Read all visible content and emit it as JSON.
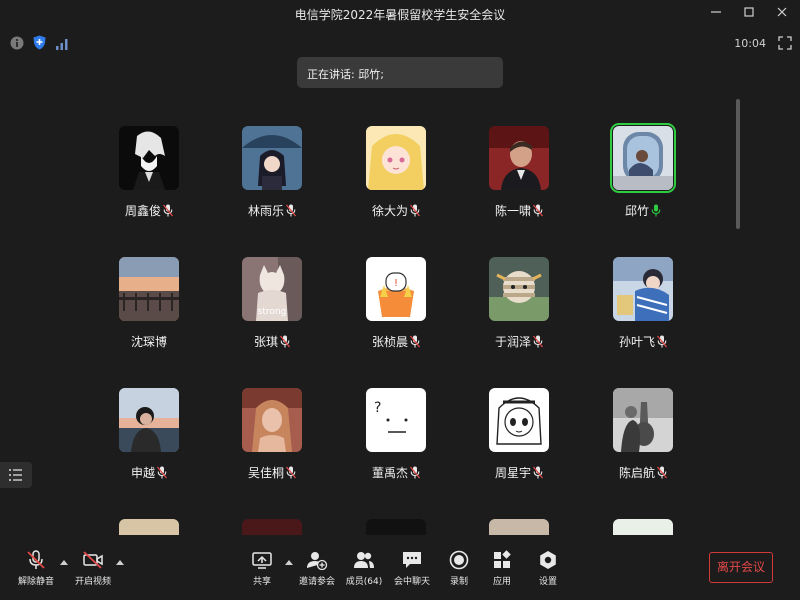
{
  "window": {
    "title": "电信学院2022年暑假留校学生安全会议",
    "min_icon": "minimize-icon",
    "max_icon": "maximize-icon",
    "close_icon": "close-icon"
  },
  "status": {
    "time": "10:04",
    "icons": [
      "info-icon",
      "shield-icon",
      "signal-icon",
      "fullscreen-icon"
    ]
  },
  "speaking": {
    "text": "正在讲话: 邱竹;"
  },
  "participants": [
    {
      "name": "周鑫俊",
      "mic": "muted",
      "avatar_color": "#0b0b0b",
      "avatar_desc": "anime-white-hair"
    },
    {
      "name": "林雨乐",
      "mic": "muted",
      "avatar_color": "#3b5b7a",
      "avatar_desc": "anime-umbrella"
    },
    {
      "name": "徐大为",
      "mic": "muted",
      "avatar_color": "#f0d27a",
      "avatar_desc": "anime-blonde"
    },
    {
      "name": "陈一啸",
      "mic": "muted",
      "avatar_color": "#7a1f1f",
      "avatar_desc": "man-portrait"
    },
    {
      "name": "邱竹",
      "mic": "speaking",
      "avatar_color": "#6d8aa8",
      "avatar_desc": "airplane-window"
    },
    {
      "name": "沈琛博",
      "mic": "none",
      "avatar_color": "#b98a6a",
      "avatar_desc": "sunset-pier"
    },
    {
      "name": "张琪",
      "mic": "muted",
      "avatar_color": "#8b7a78",
      "avatar_desc": "cat-strong",
      "avatar_text": "strong"
    },
    {
      "name": "张桢晨",
      "mic": "muted",
      "avatar_color": "#ffffff",
      "avatar_desc": "cartoon-fries"
    },
    {
      "name": "于润泽",
      "mic": "muted",
      "avatar_color": "#5a6a5a",
      "avatar_desc": "anime-bandage"
    },
    {
      "name": "孙叶飞",
      "mic": "muted",
      "avatar_color": "#a9c1dd",
      "avatar_desc": "anime-blue-kid"
    },
    {
      "name": "申越",
      "mic": "muted",
      "avatar_color": "#8fa8c8",
      "avatar_desc": "person-sea"
    },
    {
      "name": "吴佳桐",
      "mic": "muted",
      "avatar_color": "#a4665a",
      "avatar_desc": "woman-portrait"
    },
    {
      "name": "董禹杰",
      "mic": "muted",
      "avatar_color": "#ffffff",
      "avatar_desc": "doodle-face"
    },
    {
      "name": "周星宇",
      "mic": "muted",
      "avatar_color": "#ffffff",
      "avatar_desc": "anime-sketch"
    },
    {
      "name": "陈启航",
      "mic": "muted",
      "avatar_color": "#c8c8c8",
      "avatar_desc": "cello-player"
    }
  ],
  "partial_row_colors": [
    "#d8c5a5",
    "#4a1818",
    "#111111",
    "#c8b8a8",
    "#e8f0e8"
  ],
  "toolbar": {
    "unmute": "解除静音",
    "start_video": "开启视频",
    "share": "共享",
    "invite": "邀请参会",
    "members": "成员(64)",
    "chat": "会中聊天",
    "record": "录制",
    "apps": "应用",
    "settings": "设置",
    "leave": "离开会议"
  },
  "colors": {
    "background": "#1c1c1c",
    "speaking_border": "#2ecc40",
    "leave_red": "#e24848",
    "mic_muted": "#e24848"
  }
}
